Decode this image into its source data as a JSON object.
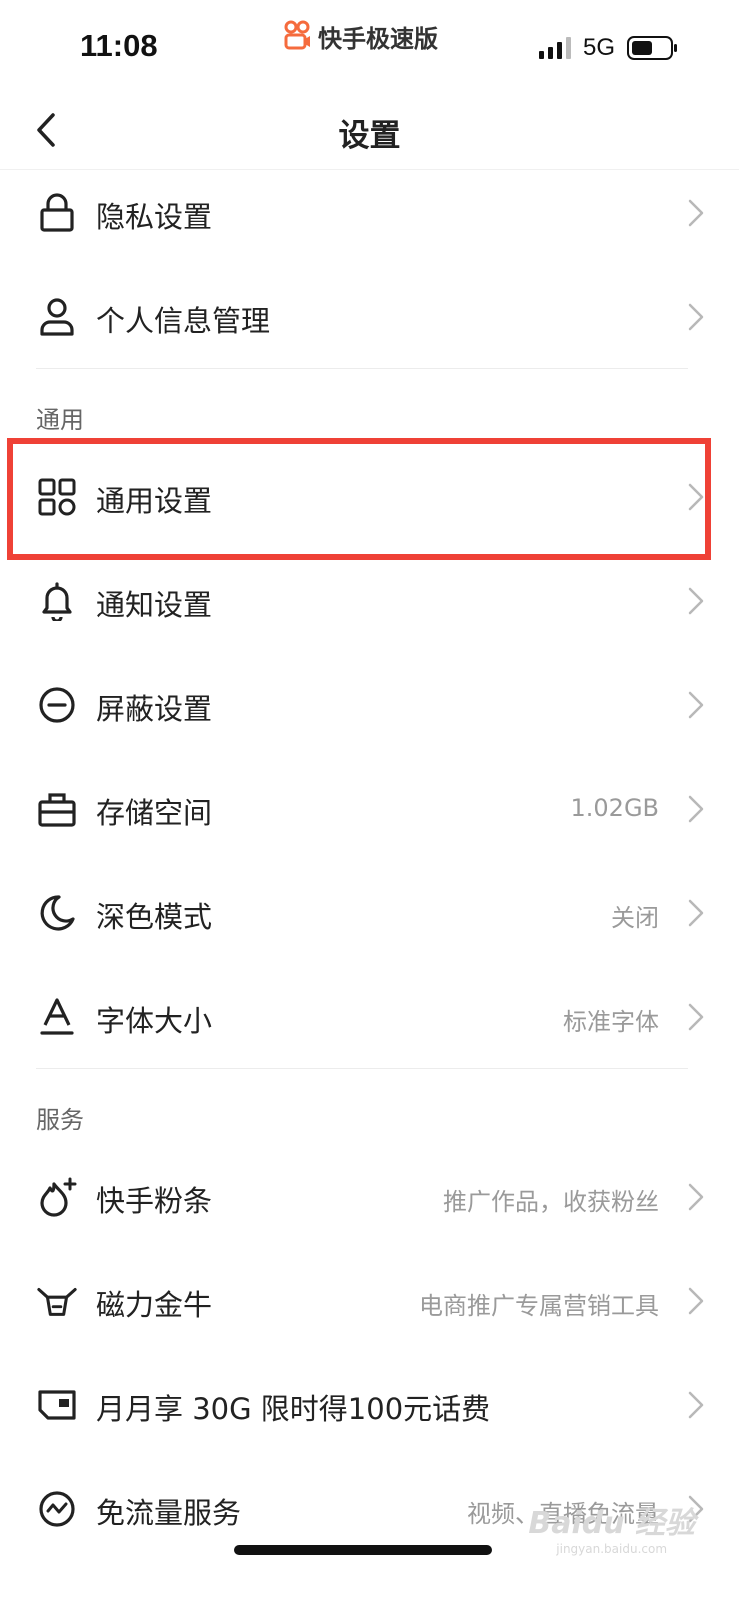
{
  "status_bar": {
    "time": "11:08",
    "app_name": "快手极速版",
    "network": "5G"
  },
  "nav": {
    "title": "设置"
  },
  "account_items": [
    {
      "label": "隐私设置",
      "value": ""
    },
    {
      "label": "个人信息管理",
      "value": ""
    }
  ],
  "general": {
    "section_title": "通用",
    "items": [
      {
        "label": "通用设置",
        "value": ""
      },
      {
        "label": "通知设置",
        "value": ""
      },
      {
        "label": "屏蔽设置",
        "value": ""
      },
      {
        "label": "存储空间",
        "value": "1.02GB"
      },
      {
        "label": "深色模式",
        "value": "关闭"
      },
      {
        "label": "字体大小",
        "value": "标准字体"
      }
    ]
  },
  "services": {
    "section_title": "服务",
    "items": [
      {
        "label": "快手粉条",
        "value": "推广作品，收获粉丝"
      },
      {
        "label": "磁力金牛",
        "value": "电商推广专属营销工具"
      },
      {
        "label": "月月享 30G 限时得100元话费",
        "value": ""
      },
      {
        "label": "免流量服务",
        "value": "视频、直播免流量"
      }
    ]
  },
  "watermark": {
    "brand": "Baidu 经验",
    "url": "jingyan.baidu.com"
  },
  "colors": {
    "highlight": "#ef4136",
    "app_logo": "#f56b3d"
  }
}
